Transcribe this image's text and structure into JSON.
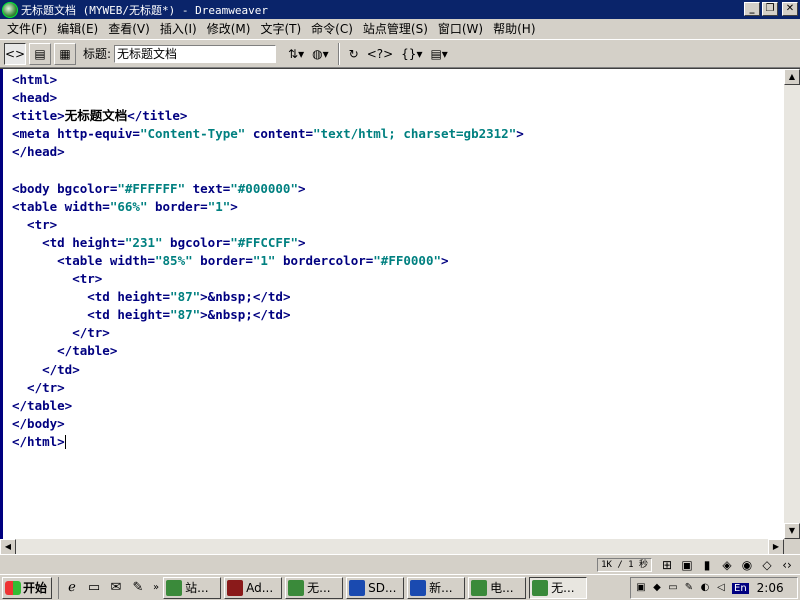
{
  "window": {
    "title": "无标题文档 (MYWEB/无标题*) - Dreamweaver"
  },
  "menubar": [
    "文件(F)",
    "编辑(E)",
    "查看(V)",
    "插入(I)",
    "修改(M)",
    "文字(T)",
    "命令(C)",
    "站点管理(S)",
    "窗口(W)",
    "帮助(H)"
  ],
  "toolbar": {
    "title_label": "标题:",
    "title_value": "无标题文档",
    "icons": [
      "code-view",
      "split-view",
      "design-view",
      "file-management",
      "preview-browser",
      "refresh",
      "reference",
      "code-navigation",
      "view-options"
    ]
  },
  "code": {
    "lines": [
      "<html>",
      "<head>",
      "<title>无标题文档</title>",
      "<meta http-equiv=\"Content-Type\" content=\"text/html; charset=gb2312\">",
      "</head>",
      "",
      "<body bgcolor=\"#FFFFFF\" text=\"#000000\">",
      "<table width=\"66%\" border=\"1\">",
      "  <tr>",
      "    <td height=\"231\" bgcolor=\"#FFCCFF\">",
      "      <table width=\"85%\" border=\"1\" bordercolor=\"#FF0000\">",
      "        <tr>",
      "          <td height=\"87\">&nbsp;</td>",
      "          <td height=\"87\">&nbsp;</td>",
      "        </tr>",
      "      </table>",
      "    </td>",
      "  </tr>",
      "</table>",
      "</body>",
      "</html>"
    ]
  },
  "statusbar": {
    "size": "1K / 1 秒"
  },
  "taskbar": {
    "start": "开始",
    "tasks": [
      {
        "label": "站...",
        "color": "#3a8a3a"
      },
      {
        "label": "Ad...",
        "color": "#8a1a1a"
      },
      {
        "label": "无...",
        "color": "#3a8a3a"
      },
      {
        "label": "SD...",
        "color": "#1a4ab0"
      },
      {
        "label": "新...",
        "color": "#1a4ab0"
      },
      {
        "label": "电...",
        "color": "#3a8a3a"
      },
      {
        "label": "无...",
        "color": "#3a8a3a",
        "active": true
      }
    ],
    "input_method": "En",
    "clock": "2:06"
  }
}
